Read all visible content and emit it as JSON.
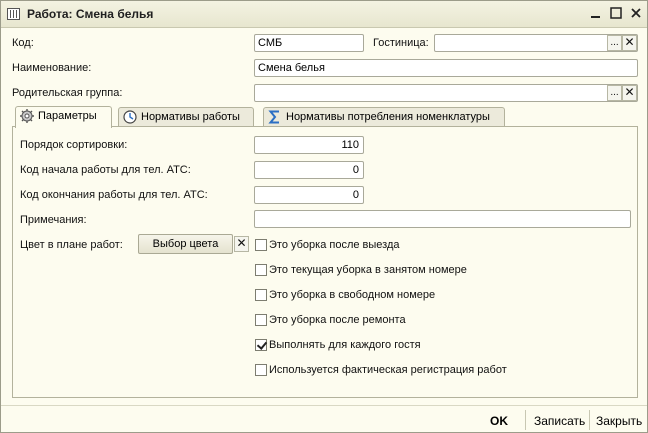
{
  "window": {
    "title": "Работа: Смена белья"
  },
  "header": {
    "code_label": "Код:",
    "code_value": "СМБ",
    "hotel_label": "Гостиница:",
    "hotel_value": "",
    "name_label": "Наименование:",
    "name_value": "Смена белья",
    "parent_label": "Родительская группа:",
    "parent_value": "",
    "select_glyph": "...",
    "clear_glyph": "✕"
  },
  "tabs": [
    {
      "label": "Параметры",
      "icon": "gear-icon",
      "active": true
    },
    {
      "label": "Нормативы работы",
      "icon": "clock-icon",
      "active": false
    },
    {
      "label": "Нормативы потребления номенклатуры",
      "icon": "sigma-icon",
      "active": false
    }
  ],
  "params": {
    "sort_label": "Порядок сортировки:",
    "sort_value": "110",
    "pbx_start_label": "Код начала работы для тел. АТС:",
    "pbx_start_value": "0",
    "pbx_end_label": "Код окончания работы для тел. АТС:",
    "pbx_end_value": "0",
    "notes_label": "Примечания:",
    "notes_value": "",
    "color_label": "Цвет в плане работ:",
    "color_button": "Выбор цвета"
  },
  "checkboxes": [
    {
      "label": "Это уборка после выезда",
      "checked": false
    },
    {
      "label": "Это текущая уборка в занятом номере",
      "checked": false
    },
    {
      "label": "Это уборка в свободном номере",
      "checked": false
    },
    {
      "label": "Это уборка после ремонта",
      "checked": false
    },
    {
      "label": "Выполнять для каждого гостя",
      "checked": true
    },
    {
      "label": "Используется фактическая регистрация работ",
      "checked": false
    }
  ],
  "footer": {
    "ok": "OK",
    "save": "Записать",
    "close": "Закрыть"
  },
  "colors": {
    "window_bg": "#fdfcef",
    "border": "#b3b29c",
    "icon_blue": "#2b6fc4"
  }
}
